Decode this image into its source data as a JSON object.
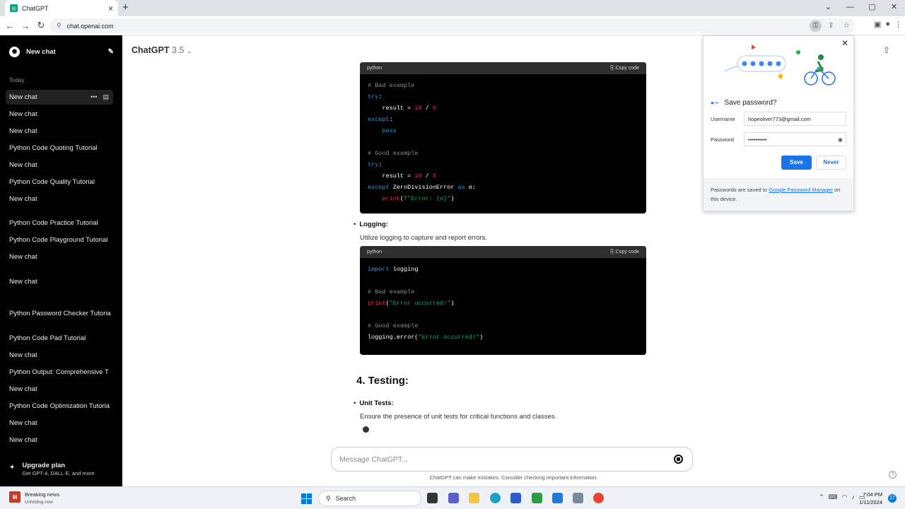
{
  "browser": {
    "tab_title": "ChatGPT",
    "url": "chat.openai.com"
  },
  "sidebar": {
    "new_chat": "New chat",
    "section": "Today",
    "items": [
      {
        "label": "New chat",
        "active": true
      },
      {
        "label": "New chat"
      },
      {
        "label": "New chat"
      },
      {
        "label": "Python Code Quoting Tutorial"
      },
      {
        "label": "New chat"
      },
      {
        "label": "Python Code Quality Tutorial"
      },
      {
        "label": "New chat"
      },
      {
        "label": "Python Code Practice Tutorial"
      },
      {
        "label": "Python Code Playground Tutorial"
      },
      {
        "label": "New chat"
      },
      {
        "label": "New chat"
      },
      {
        "label": "Python Password Checker Tutoria"
      },
      {
        "label": "Python Code Pad Tutorial"
      },
      {
        "label": "New chat"
      },
      {
        "label": "Python Output: Comprehensive T"
      },
      {
        "label": "New chat"
      },
      {
        "label": "Python Code Optimization Tutoria"
      },
      {
        "label": "New chat"
      },
      {
        "label": "New chat"
      }
    ],
    "upgrade_title": "Upgrade plan",
    "upgrade_sub": "Get GPT-4, DALL·E, and more"
  },
  "main": {
    "model_name": "ChatGPT",
    "model_version": "3.5",
    "code1_lang": "python",
    "copy_label": "Copy code",
    "bullet_logging": "Logging:",
    "logging_desc": "Utilize logging to capture and report errors.",
    "code2_lang": "python",
    "heading_testing": "4. Testing:",
    "bullet_unit": "Unit Tests:",
    "unit_desc": "Ensure the presence of unit tests for critical functions and classes.",
    "composer_placeholder": "Message ChatGPT...",
    "disclaimer": "ChatGPT can make mistakes. Consider checking important information.",
    "help": "?"
  },
  "password_popup": {
    "title": "Save password?",
    "username_label": "Username",
    "username_value": "hopeoliver773@gmail.com",
    "password_label": "Password",
    "password_value": "••••••••••",
    "save_label": "Save",
    "never_label": "Never",
    "footer_pre": "Passwords are saved to ",
    "footer_link": "Google Password Manager",
    "footer_post": " on this device."
  },
  "taskbar": {
    "news_title": "Breaking news",
    "news_sub": "Unfolding now",
    "search_label": "Search",
    "time": "7:04 PM",
    "date": "1/11/2024",
    "notif_count": "17"
  }
}
